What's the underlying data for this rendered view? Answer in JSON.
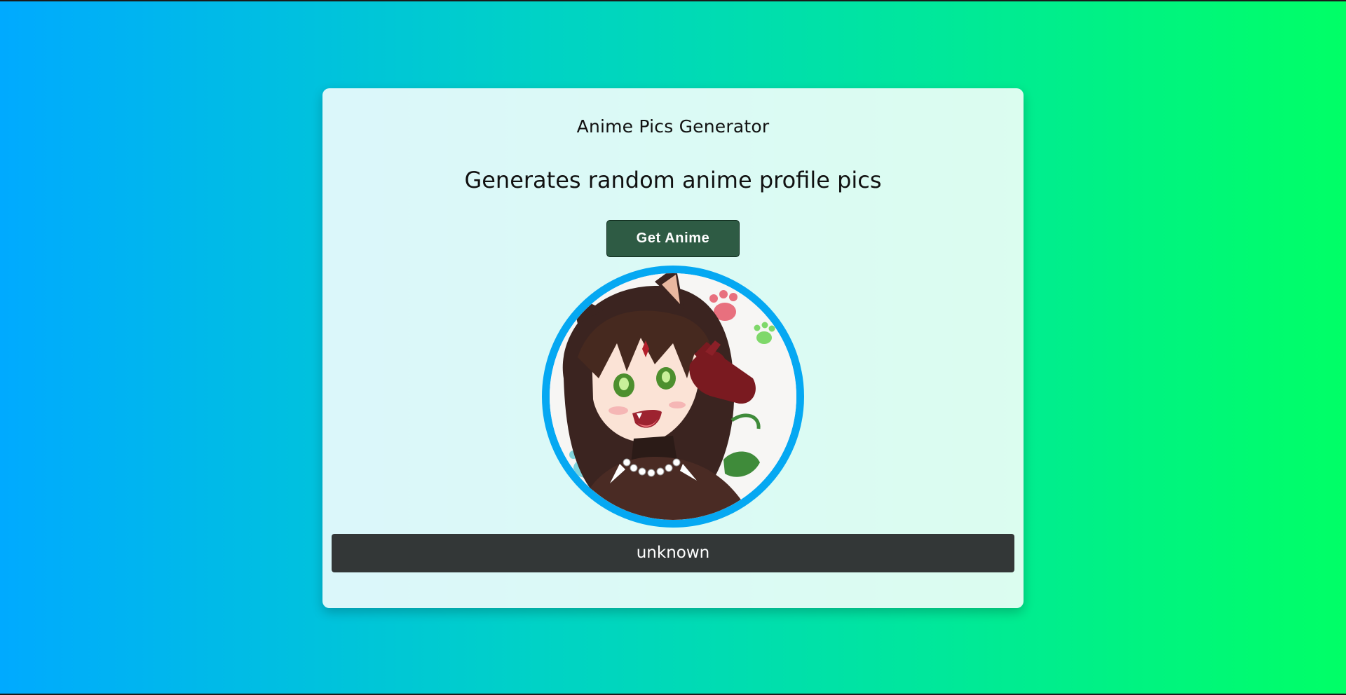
{
  "app": {
    "title": "Anime Pics Generator",
    "subtitle": "Generates random anime profile pics"
  },
  "actions": {
    "get_anime_label": "Get Anime"
  },
  "result": {
    "artist_name": "unknown",
    "image_description": "anime character with cat ears and brown hair"
  },
  "colors": {
    "background_start": "#00aaff",
    "background_end": "#00ff66",
    "button_bg": "#2e5b44",
    "avatar_ring": "#05a8f2",
    "name_bar_bg": "#333737"
  }
}
